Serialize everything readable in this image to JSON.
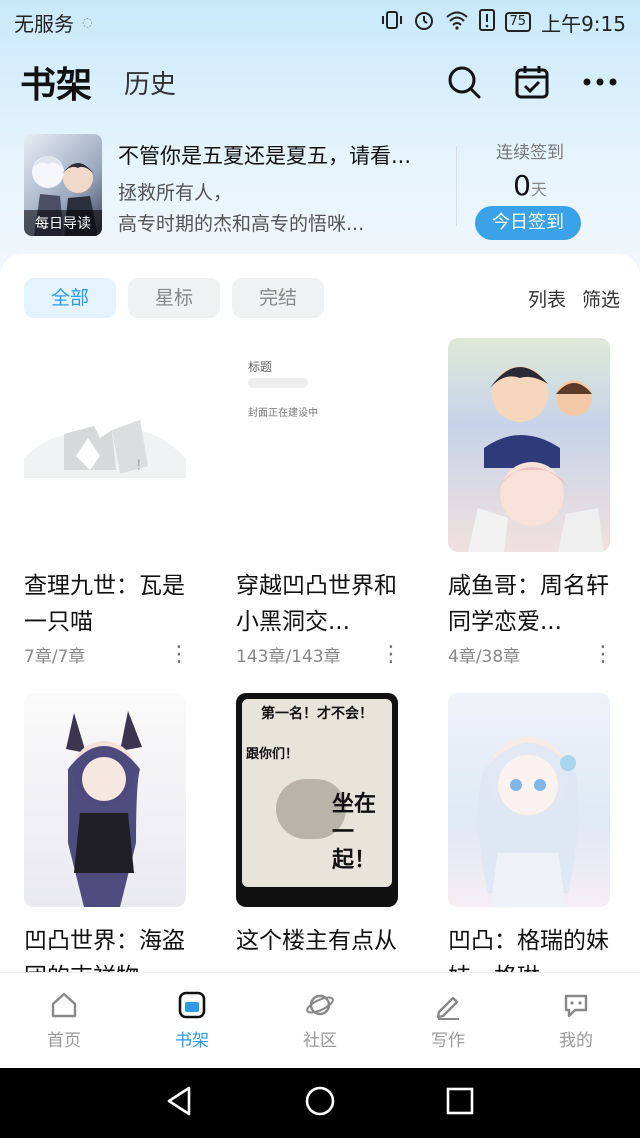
{
  "status_bar": {
    "carrier": "无服务",
    "battery": "75",
    "time": "上午9:15"
  },
  "header": {
    "title": "书架",
    "history_tab": "历史",
    "icons": [
      "search-icon",
      "calendar-check-icon",
      "more-icon"
    ]
  },
  "banner": {
    "tag": "每日导读",
    "title": "不管你是五夏还是夏五，请看...",
    "line2": "拯救所有人，",
    "line3": "高专时期的杰和高专的悟咪..."
  },
  "checkin": {
    "label": "连续签到",
    "days": "0",
    "unit": "天",
    "button": "今日签到"
  },
  "filters": {
    "chips": [
      "全部",
      "星标",
      "完结"
    ],
    "active": 0,
    "list_view": "列表",
    "filter": "筛选"
  },
  "books": [
    {
      "title": "查理九世：瓦是一只喵",
      "progress": "7章/7章"
    },
    {
      "title": "穿越凹凸世界和小黑洞交...",
      "progress": "143章/143章"
    },
    {
      "title": "咸鱼哥：周名轩同学恋爱...",
      "progress": "4章/38章"
    },
    {
      "title": "凹凸世界：海盗团的吉祥物",
      "progress": ""
    },
    {
      "title": "这个楼主有点从",
      "progress": ""
    },
    {
      "title": "凹凸：格瑞的妹妹，格琳",
      "progress": ""
    }
  ],
  "cover_texts": {
    "placeholder_title": "标题",
    "placeholder_status": "封面正在建设中",
    "meme_top": "第一名！才不会！",
    "meme_left": "跟你们！",
    "meme_main": "坐在一起！"
  },
  "tabbar": {
    "items": [
      {
        "label": "首页",
        "icon": "home-icon"
      },
      {
        "label": "书架",
        "icon": "bookshelf-icon"
      },
      {
        "label": "社区",
        "icon": "planet-icon"
      },
      {
        "label": "写作",
        "icon": "pen-icon"
      },
      {
        "label": "我的",
        "icon": "chat-bubble-icon"
      }
    ],
    "active": 1
  },
  "colors": {
    "accent": "#2e9be6",
    "checkin_button": "#3aa2e8",
    "header_gradient_top": "#c9e9fb"
  }
}
